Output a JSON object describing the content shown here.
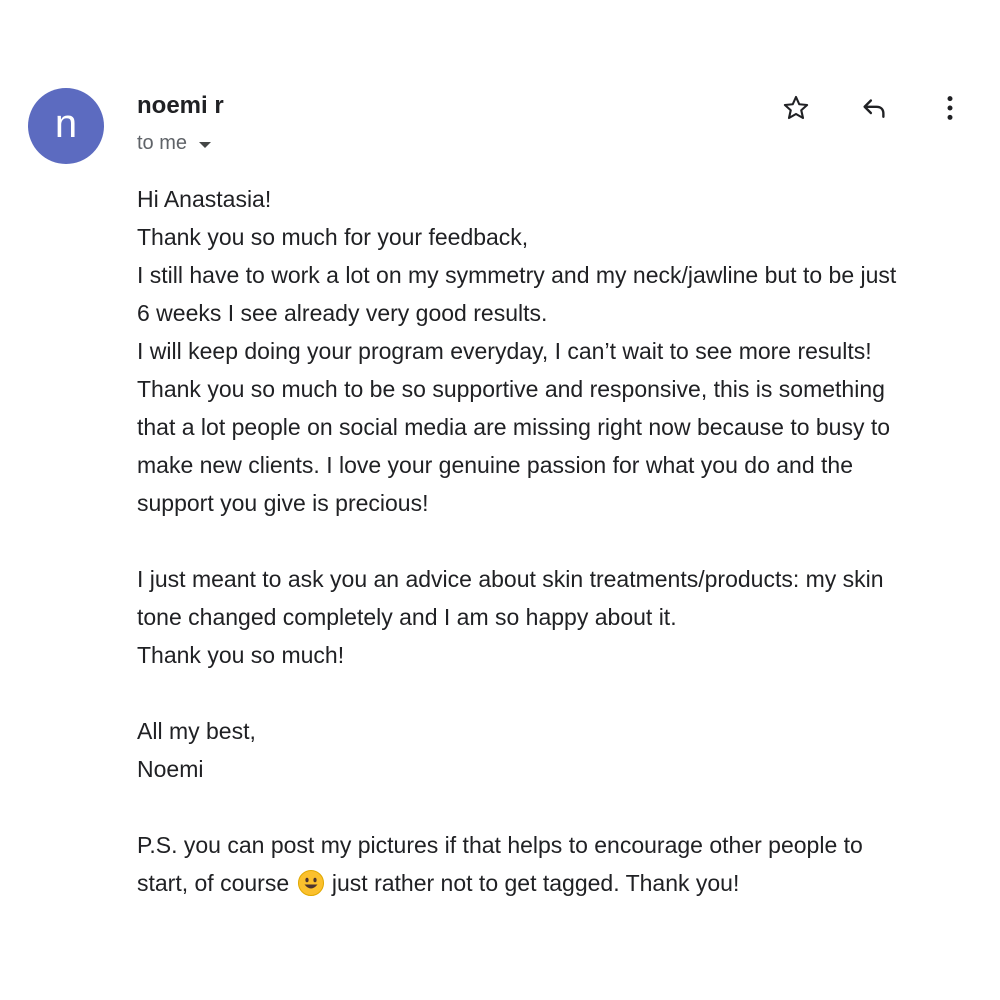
{
  "sender": {
    "initial": "n",
    "name": "noemi r",
    "recipient_label": "to me",
    "avatar_color": "#5c6bc0"
  },
  "actions": {
    "star_icon": "star-outline-icon",
    "reply_icon": "reply-icon",
    "more_icon": "more-vertical-icon"
  },
  "body": {
    "greeting": "Hi Anastasia!",
    "p1": [
      "Thank you so much for your feedback,",
      "I still have to work a lot on my symmetry and my neck/jawline but to be just",
      "6 weeks I see already very good results.",
      "I will keep doing your program everyday, I can’t wait to see more results!",
      "Thank you so much to be so supportive and responsive, this is something",
      "that a lot people on social media are missing right now because to busy to",
      "make new clients. I love your genuine passion for what you do and the",
      "support you give is precious!"
    ],
    "p2": [
      "I just meant to ask you an advice about skin treatments/products: my skin",
      "tone changed completely and I am so happy about it.",
      "Thank you so much!"
    ],
    "signoff": [
      "All my best,",
      "Noemi"
    ],
    "ps_line1": "P.S. you can post my pictures if that helps to encourage other people to",
    "ps_line2_before": "start, of course",
    "ps_emoji": "smiling-face-emoji",
    "ps_line2_after": "just rather not to get tagged. Thank you!"
  }
}
